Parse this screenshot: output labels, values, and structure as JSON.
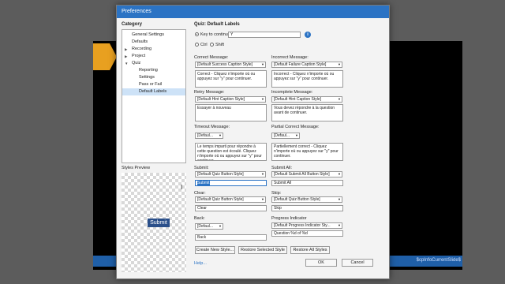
{
  "background": {
    "status_text": "$cpInfoCurrentSlide$"
  },
  "dialog": {
    "title": "Preferences",
    "category_heading": "Category",
    "tree": [
      {
        "label": "General Settings",
        "expander": ""
      },
      {
        "label": "Defaults",
        "expander": ""
      },
      {
        "label": "Recording",
        "expander": "▶"
      },
      {
        "label": "Project",
        "expander": "▶"
      },
      {
        "label": "Quiz",
        "expander": "▼"
      },
      {
        "label": "Reporting",
        "expander": ""
      },
      {
        "label": "Settings",
        "expander": ""
      },
      {
        "label": "Pass or Fail",
        "expander": ""
      },
      {
        "label": "Default Labels",
        "expander": ""
      }
    ],
    "styles_preview_heading": "Styles Preview",
    "preview_button": "Submit",
    "panel_title": "Quiz: Default Labels",
    "key_to_continue_label": "Key to continue",
    "key_value": "Y",
    "ctrl_label": "Ctrl",
    "shift_label": "Shift",
    "correct": {
      "label": "Correct Message:",
      "style": "[Default Success Caption Style]",
      "text": "Correct - Cliquez n'importe où ou appuyez sur \"y\" pour continuer."
    },
    "incorrect": {
      "label": "Incorrect Message:",
      "style": "[Default Failure Caption Style]",
      "text": "Incorrect - Cliquez n'importe où ou appuyez sur \"y\" pour continuer."
    },
    "retry": {
      "label": "Retry Message:",
      "style": "[Default Hint Caption Style]",
      "text": "Essayer à nouveau"
    },
    "incomplete": {
      "label": "Incomplete Message:",
      "style": "[Default Hint Caption Style]",
      "text": "Vous devez répondre à la question avant de continuer."
    },
    "timeout": {
      "label": "Timeout Message:",
      "style": "[Defaul...",
      "text": "Le temps imparti pour répondre à cette question est écoulé. Cliquez n'importe où ou appuyez sur \"y\" pour continuer."
    },
    "partial": {
      "label": "Partial Correct Message:",
      "style": "[Defaul...",
      "text": "Partiellement correct - Cliquez n'importe où ou appuyez sur \"y\" pour continuer."
    },
    "submit": {
      "label": "Submit:",
      "style": "[Default Quiz Button Style]",
      "value": "Submit"
    },
    "submit_all": {
      "label": "Submit All:",
      "style": "[Default Submit All Button Style]",
      "value": "Submit All"
    },
    "clear": {
      "label": "Clear:",
      "style": "[Default Quiz Button Style]",
      "value": "Clear"
    },
    "skip": {
      "label": "Skip:",
      "style": "[Default Quiz Button Style]",
      "value": "Skip"
    },
    "back": {
      "label": "Back:",
      "style": "[Defaul...",
      "value": "Back"
    },
    "progress": {
      "label": "Progress Indicator",
      "style": "[Default Progress Indicator Sty...",
      "value": "Question %d of %d"
    },
    "buttons": {
      "create": "Create New Style...",
      "restore_selected": "Restore Selected Style",
      "restore_all": "Restore All Styles",
      "ok": "OK",
      "cancel": "Cancel"
    },
    "help": "Help..."
  }
}
